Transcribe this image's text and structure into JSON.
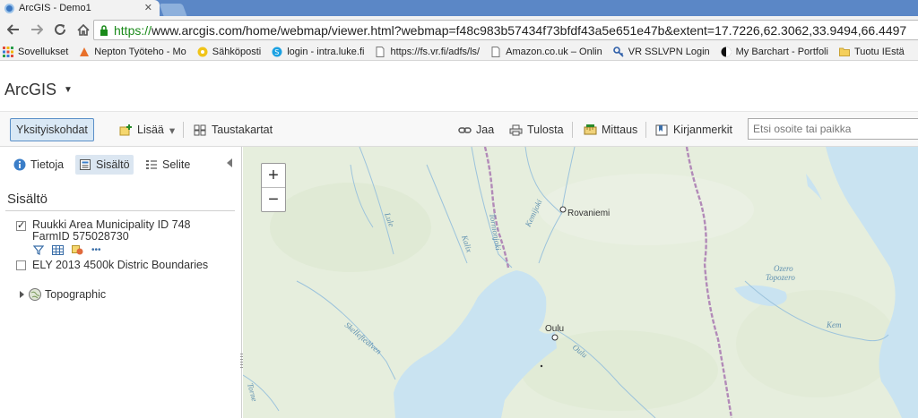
{
  "browser": {
    "tab_title": "ArcGIS - Demo1",
    "tab_close": "✕",
    "url_protocol": "https://",
    "url_rest": "www.arcgis.com/home/webmap/viewer.html?webmap=f48c983b57434f73bfdf43a5e651e47b&extent=17.7226,62.3062,33.9494,66.4497",
    "bookmarks": [
      {
        "label": "Sovellukset",
        "icon": "apps-grid-icon"
      },
      {
        "label": "Nepton Työteho - Mo",
        "icon": "nepton-icon"
      },
      {
        "label": "Sähköposti",
        "icon": "mail-icon"
      },
      {
        "label": "login - intra.luke.fi",
        "icon": "skype-icon"
      },
      {
        "label": "https://fs.vr.fi/adfs/ls/",
        "icon": "page-icon"
      },
      {
        "label": "Amazon.co.uk – Onlin",
        "icon": "page-icon"
      },
      {
        "label": "VR SSLVPN Login",
        "icon": "key-icon"
      },
      {
        "label": "My Barchart - Portfoli",
        "icon": "barchart-icon"
      },
      {
        "label": "Tuotu IEstä",
        "icon": "folder-icon"
      }
    ]
  },
  "app": {
    "title": "ArcGIS",
    "title_caret": "▼"
  },
  "toolbar": {
    "details": "Yksityiskohdat",
    "add": "Lisää",
    "add_caret": "▾",
    "basemaps": "Taustakartat",
    "share": "Jaa",
    "print": "Tulosta",
    "measure": "Mittaus",
    "bookmarks": "Kirjanmerkit",
    "search_placeholder": "Etsi osoite tai paikka"
  },
  "panel": {
    "tabs": [
      {
        "label": "Tietoja",
        "icon": "info-icon"
      },
      {
        "label": "Sisältö",
        "icon": "content-icon",
        "active": true
      },
      {
        "label": "Selite",
        "icon": "legend-icon"
      }
    ],
    "heading": "Sisältö",
    "layers": [
      {
        "name_line1": "Ruukki Area Municipality ID 748",
        "name_line2": "FarmID 575028730",
        "checked": true
      },
      {
        "name_line1": "ELY 2013 4500k Distric Boundaries",
        "checked": false
      }
    ],
    "layer_more": "•••",
    "basemap_name": "Topographic"
  },
  "map": {
    "zoom_in": "+",
    "zoom_out": "−",
    "places": [
      "Rovaniemi",
      "Oulu"
    ],
    "rivers": [
      "Lule",
      "Kalix",
      "Tornionjoki",
      "Kemijoki",
      "Skellefteälven",
      "Oulu",
      "Kem",
      "Torne"
    ],
    "lakes": [
      "Ozero",
      "Topozero"
    ]
  }
}
